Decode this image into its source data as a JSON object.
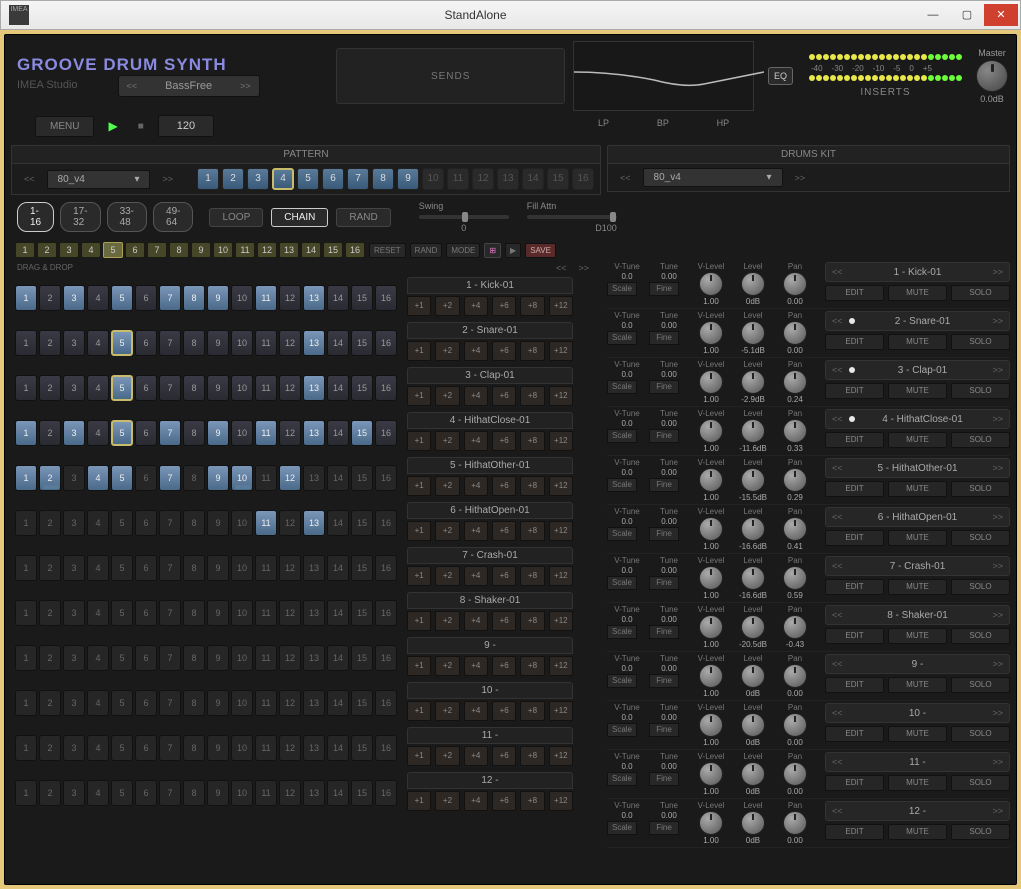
{
  "window": {
    "title": "StandAlone",
    "icon": "IMEA"
  },
  "header": {
    "logo": "GROOVE DRUM SYNTH",
    "sublogo": "IMEA Studio",
    "preset": "BassFree",
    "sends_label": "SENDS",
    "eq_labels": [
      "LP",
      "BP",
      "HP"
    ],
    "eq_btn": "EQ",
    "meter_scale": [
      "-40",
      "-30",
      "-20",
      "-10",
      "-5",
      "0",
      "+5"
    ],
    "inserts_label": "INSERTS",
    "master_label": "Master",
    "master_value": "0.0dB",
    "menu_label": "MENU",
    "tempo": "120"
  },
  "pattern": {
    "label": "PATTERN",
    "name": "80_v4",
    "numbers": [
      1,
      2,
      3,
      4,
      5,
      6,
      7,
      8,
      9,
      10,
      11,
      12,
      13,
      14,
      15,
      16
    ],
    "active_range": 9,
    "selected": 4,
    "ranges": [
      "1-16",
      "17-32",
      "33-48",
      "49-64"
    ],
    "range_active": 0,
    "modes": {
      "loop": "LOOP",
      "chain": "CHAIN",
      "rand": "RAND",
      "chain_active": true
    },
    "swing_label": "Swing",
    "swing_value": "0",
    "fill_label": "Fill Attn",
    "fill_value": "D100",
    "small_selected": 5,
    "util": {
      "reset": "RESET",
      "rand": "RAND",
      "mode": "MODE",
      "save": "SAVE"
    },
    "dragdrop": "DRAG & DROP"
  },
  "tracks": [
    {
      "label": "1 - Kick-01",
      "on": [
        1,
        3,
        5,
        7,
        8,
        9,
        11,
        13
      ],
      "sel": []
    },
    {
      "label": "2 - Snare-01",
      "on": [
        5,
        13
      ],
      "sel": [
        5
      ]
    },
    {
      "label": "3 - Clap-01",
      "on": [
        5,
        13
      ],
      "sel": [
        5
      ]
    },
    {
      "label": "4 - HithatClose-01",
      "on": [
        1,
        3,
        5,
        7,
        9,
        11,
        13,
        15
      ],
      "sel": [
        5
      ]
    },
    {
      "label": "5 - HithatOther-01",
      "on": [
        1,
        2,
        4,
        5,
        7,
        9,
        10,
        12
      ],
      "sel": [],
      "tick": [
        2,
        10
      ]
    },
    {
      "label": "6 - HithatOpen-01",
      "on": [
        11,
        13
      ],
      "sel": []
    },
    {
      "label": "7 - Crash-01",
      "on": [],
      "sel": []
    },
    {
      "label": "8 - Shaker-01",
      "on": [],
      "sel": []
    },
    {
      "label": "9 -",
      "on": [],
      "sel": []
    },
    {
      "label": "10 -",
      "on": [],
      "sel": []
    },
    {
      "label": "11 -",
      "on": [],
      "sel": []
    },
    {
      "label": "12 -",
      "on": [],
      "sel": []
    }
  ],
  "velocity_labels": [
    "+1",
    "+2",
    "+4",
    "+6",
    "+8",
    "+12"
  ],
  "drums_kit": {
    "label": "DRUMS KIT",
    "name": "80_v4"
  },
  "kit_rows": [
    {
      "name": "1 - Kick-01",
      "vtune": "0.0",
      "tune": "0.00",
      "vlevel": "1.00",
      "level": "0dB",
      "pan": "0.00",
      "dot": false
    },
    {
      "name": "2 - Snare-01",
      "vtune": "0.0",
      "tune": "0.00",
      "vlevel": "1.00",
      "level": "-5.1dB",
      "pan": "0.00",
      "dot": true
    },
    {
      "name": "3 - Clap-01",
      "vtune": "0.0",
      "tune": "0.00",
      "vlevel": "1.00",
      "level": "-2.9dB",
      "pan": "0.24",
      "dot": true
    },
    {
      "name": "4 - HithatClose-01",
      "vtune": "0.0",
      "tune": "0.00",
      "vlevel": "1.00",
      "level": "-11.6dB",
      "pan": "0.33",
      "dot": true
    },
    {
      "name": "5 - HithatOther-01",
      "vtune": "0.0",
      "tune": "0.00",
      "vlevel": "1.00",
      "level": "-15.5dB",
      "pan": "0.29",
      "dot": false
    },
    {
      "name": "6 - HithatOpen-01",
      "vtune": "0.0",
      "tune": "0.00",
      "vlevel": "1.00",
      "level": "-16.6dB",
      "pan": "0.41",
      "dot": false
    },
    {
      "name": "7 - Crash-01",
      "vtune": "0.0",
      "tune": "0.00",
      "vlevel": "1.00",
      "level": "-16.6dB",
      "pan": "0.59",
      "dot": false
    },
    {
      "name": "8 - Shaker-01",
      "vtune": "0.0",
      "tune": "0.00",
      "vlevel": "1.00",
      "level": "-20.5dB",
      "pan": "-0.43",
      "dot": false
    },
    {
      "name": "9 -",
      "vtune": "0.0",
      "tune": "0.00",
      "vlevel": "1.00",
      "level": "0dB",
      "pan": "0.00",
      "dot": false
    },
    {
      "name": "10 -",
      "vtune": "0.0",
      "tune": "0.00",
      "vlevel": "1.00",
      "level": "0dB",
      "pan": "0.00",
      "dot": false
    },
    {
      "name": "11 -",
      "vtune": "0.0",
      "tune": "0.00",
      "vlevel": "1.00",
      "level": "0dB",
      "pan": "0.00",
      "dot": false
    },
    {
      "name": "12 -",
      "vtune": "0.0",
      "tune": "0.00",
      "vlevel": "1.00",
      "level": "0dB",
      "pan": "0.00",
      "dot": false
    }
  ],
  "kit_col_labels": {
    "vtune": "V-Tune",
    "tune": "Tune",
    "vlevel": "V-Level",
    "level": "Level",
    "pan": "Pan",
    "scale": "Scale",
    "fine": "Fine"
  },
  "kit_actions": {
    "edit": "EDIT",
    "mute": "MUTE",
    "solo": "SOLO"
  }
}
